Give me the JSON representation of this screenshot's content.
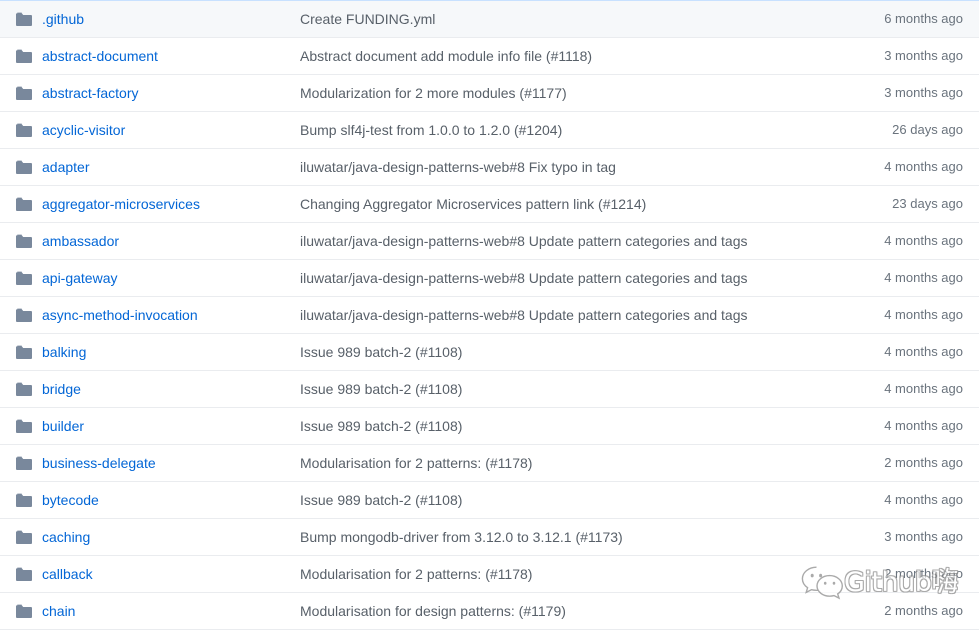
{
  "colors": {
    "link": "#0366d6",
    "message_text": "#586069",
    "age_text": "#6a737d",
    "row_border": "#eaecef",
    "table_top_border": "#c8e1ff",
    "highlight_row_bg": "#f6f8fa",
    "folder_icon": "#79889c",
    "page_bg": "#ffffff"
  },
  "table": {
    "icon_name": "folder-icon",
    "columns": [
      "name",
      "latest_commit_message",
      "last_commit_age"
    ],
    "rows": [
      {
        "name": ".github",
        "message": "Create FUNDING.yml",
        "age": "6 months ago",
        "highlighted": true
      },
      {
        "name": "abstract-document",
        "message": "Abstract document add module info file (#1118)",
        "age": "3 months ago",
        "highlighted": false
      },
      {
        "name": "abstract-factory",
        "message": "Modularization for 2 more modules (#1177)",
        "age": "3 months ago",
        "highlighted": false
      },
      {
        "name": "acyclic-visitor",
        "message": "Bump slf4j-test from 1.0.0 to 1.2.0 (#1204)",
        "age": "26 days ago",
        "highlighted": false
      },
      {
        "name": "adapter",
        "message": "iluwatar/java-design-patterns-web#8 Fix typo in tag",
        "age": "4 months ago",
        "highlighted": false
      },
      {
        "name": "aggregator-microservices",
        "message": "Changing Aggregator Microservices pattern link (#1214)",
        "age": "23 days ago",
        "highlighted": false
      },
      {
        "name": "ambassador",
        "message": "iluwatar/java-design-patterns-web#8 Update pattern categories and tags",
        "age": "4 months ago",
        "highlighted": false
      },
      {
        "name": "api-gateway",
        "message": "iluwatar/java-design-patterns-web#8 Update pattern categories and tags",
        "age": "4 months ago",
        "highlighted": false
      },
      {
        "name": "async-method-invocation",
        "message": "iluwatar/java-design-patterns-web#8 Update pattern categories and tags",
        "age": "4 months ago",
        "highlighted": false
      },
      {
        "name": "balking",
        "message": "Issue 989 batch-2 (#1108)",
        "age": "4 months ago",
        "highlighted": false
      },
      {
        "name": "bridge",
        "message": "Issue 989 batch-2 (#1108)",
        "age": "4 months ago",
        "highlighted": false
      },
      {
        "name": "builder",
        "message": "Issue 989 batch-2 (#1108)",
        "age": "4 months ago",
        "highlighted": false
      },
      {
        "name": "business-delegate",
        "message": "Modularisation for 2 patterns: (#1178)",
        "age": "2 months ago",
        "highlighted": false
      },
      {
        "name": "bytecode",
        "message": "Issue 989 batch-2 (#1108)",
        "age": "4 months ago",
        "highlighted": false
      },
      {
        "name": "caching",
        "message": "Bump mongodb-driver from 3.12.0 to 3.12.1 (#1173)",
        "age": "3 months ago",
        "highlighted": false
      },
      {
        "name": "callback",
        "message": "Modularisation for 2 patterns: (#1178)",
        "age": "2 months ago",
        "highlighted": false
      },
      {
        "name": "chain",
        "message": "Modularisation for design patterns: (#1179)",
        "age": "2 months ago",
        "highlighted": false
      }
    ]
  },
  "watermark": {
    "text": "Github嗨",
    "logo_name": "wechat-logo-icon"
  }
}
